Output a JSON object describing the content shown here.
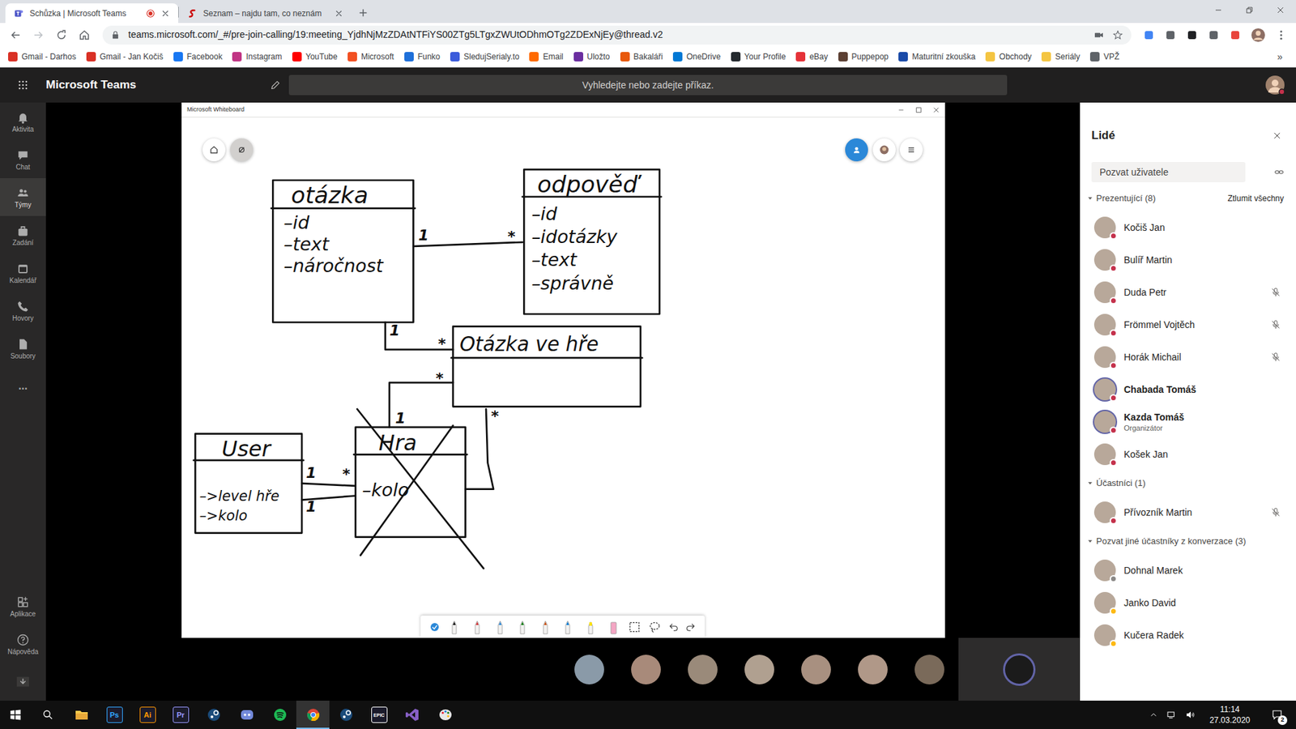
{
  "browser": {
    "tabs": [
      {
        "label": "Schůzka | Microsoft Teams",
        "selected": true,
        "recording": true
      },
      {
        "label": "Seznam – najdu tam, co neznám",
        "selected": false,
        "recording": false
      }
    ],
    "address": "teams.microsoft.com/_#/pre-join-calling/19:meeting_YjdhNjMzZDAtNTFiYS00ZTg5LTgxZWUtODhmOTg2ZDExNjEy@thread.v2",
    "bookmarks": [
      {
        "label": "Gmail - Darhos",
        "color": "#d93025"
      },
      {
        "label": "Gmail - Jan Kočiš",
        "color": "#d93025"
      },
      {
        "label": "Facebook",
        "color": "#1877f2"
      },
      {
        "label": "Instagram",
        "color": "#c13584"
      },
      {
        "label": "YouTube",
        "color": "#ff0000"
      },
      {
        "label": "Microsoft",
        "color": "#f25022"
      },
      {
        "label": "Funko",
        "color": "#1e6fd9"
      },
      {
        "label": "SledujSerialy.to",
        "color": "#3b5bdb"
      },
      {
        "label": "Email",
        "color": "#ff6a00"
      },
      {
        "label": "Uložto",
        "color": "#6b2fa0"
      },
      {
        "label": "Bakaláři",
        "color": "#e8590c"
      },
      {
        "label": "OneDrive",
        "color": "#0078d4"
      },
      {
        "label": "Your Profile",
        "color": "#24292e"
      },
      {
        "label": "eBay",
        "color": "#e53238"
      },
      {
        "label": "Puppepop",
        "color": "#5c4033"
      },
      {
        "label": "Maturitní zkouška",
        "color": "#1a4aa8"
      },
      {
        "label": "Obchody",
        "color": "#f4c542"
      },
      {
        "label": "Seriály",
        "color": "#f4c542"
      },
      {
        "label": "VPŽ",
        "color": "#5f6368"
      }
    ],
    "bookmarks_more": "»"
  },
  "teams": {
    "title": "Microsoft Teams",
    "search_placeholder": "Vyhledejte nebo zadejte příkaz.",
    "rail": [
      {
        "label": "Aktivita",
        "selected": false
      },
      {
        "label": "Chat",
        "selected": false
      },
      {
        "label": "Týmy",
        "selected": true
      },
      {
        "label": "Zadání",
        "selected": false
      },
      {
        "label": "Kalendář",
        "selected": false
      },
      {
        "label": "Hovory",
        "selected": false
      },
      {
        "label": "Soubory",
        "selected": false
      }
    ],
    "rail_more": "...",
    "rail_bottom": [
      {
        "label": "Aplikace"
      },
      {
        "label": "Nápověda"
      }
    ]
  },
  "whiteboard": {
    "title": "Microsoft Whiteboard",
    "classes": [
      {
        "name": "otázka",
        "fields": [
          "–id",
          "–text",
          "–náročnost"
        ],
        "crossed_out": false
      },
      {
        "name": "odpověď",
        "fields": [
          "–id",
          "–idotázky",
          "–text",
          "–správně"
        ],
        "crossed_out": false
      },
      {
        "name": "Otázka ve hře",
        "fields": [],
        "crossed_out": false
      },
      {
        "name": "User",
        "fields": [
          "–>level hře",
          "–>kolo"
        ],
        "crossed_out": false
      },
      {
        "name": "Hra",
        "fields": [
          "–kolo"
        ],
        "crossed_out": true
      }
    ],
    "links": [
      {
        "ends": [
          "1",
          "*"
        ]
      },
      {
        "ends": [
          "1",
          "*"
        ]
      },
      {
        "ends": [
          "*",
          "1"
        ]
      },
      {
        "ends": [
          "*"
        ]
      },
      {
        "ends": [
          "1",
          "*"
        ]
      },
      {
        "ends": [
          "1"
        ]
      }
    ]
  },
  "people": {
    "title": "Lidé",
    "invite_placeholder": "Pozvat uživatele",
    "groups": [
      {
        "label": "Prezentující (8)",
        "action": "Ztlumit všechny",
        "expanded": true,
        "members": [
          {
            "name": "Kočiš Jan",
            "muted": false,
            "highlighted": false,
            "status_color": "#c4314b"
          },
          {
            "name": "Bulíř Martin",
            "muted": false,
            "highlighted": false,
            "status_color": "#c4314b"
          },
          {
            "name": "Duda Petr",
            "muted": true,
            "highlighted": false,
            "status_color": "#c4314b"
          },
          {
            "name": "Frömmel Vojtěch",
            "muted": true,
            "highlighted": false,
            "status_color": "#c4314b"
          },
          {
            "name": "Horák Michail",
            "muted": true,
            "highlighted": false,
            "status_color": "#c4314b"
          },
          {
            "name": "Chabada Tomáš",
            "muted": false,
            "highlighted": true,
            "status_color": "#c4314b"
          },
          {
            "name": "Kazda Tomáš",
            "role": "Organizátor",
            "muted": false,
            "highlighted": true,
            "status_color": "#c4314b"
          },
          {
            "name": "Košek Jan",
            "muted": false,
            "highlighted": false,
            "status_color": "#c4314b"
          }
        ]
      },
      {
        "label": "Účastníci (1)",
        "expanded": true,
        "members": [
          {
            "name": "Přívozník Martin",
            "muted": true,
            "highlighted": false,
            "status_color": "#c4314b"
          }
        ]
      },
      {
        "label": "Pozvat jiné účastníky z konverzace (3)",
        "expanded": true,
        "members": [
          {
            "name": "Dohnal Marek",
            "muted": false,
            "highlighted": false,
            "status_color": "#8a8886"
          },
          {
            "name": "Janko David",
            "muted": false,
            "highlighted": false,
            "status_color": "#fdb913"
          },
          {
            "name": "Kučera Radek",
            "muted": false,
            "highlighted": false,
            "status_color": "#fdb913"
          }
        ]
      }
    ]
  },
  "taskbar": {
    "apps": [
      {
        "kind": "explorer",
        "active": false
      },
      {
        "kind": "label",
        "label": "Ps",
        "color": "#31a8ff",
        "active": false
      },
      {
        "kind": "label",
        "label": "Ai",
        "color": "#ff9a00",
        "active": false
      },
      {
        "kind": "label",
        "label": "Pr",
        "color": "#9999ff",
        "active": false
      },
      {
        "kind": "steam",
        "active": false
      },
      {
        "kind": "discord",
        "active": false
      },
      {
        "kind": "spotify",
        "active": false
      },
      {
        "kind": "chrome",
        "active": true
      },
      {
        "kind": "steam",
        "active": false
      },
      {
        "kind": "label",
        "label": "EPIC",
        "color": "#ffffff",
        "active": false
      },
      {
        "kind": "vs",
        "active": false
      },
      {
        "kind": "paint",
        "active": false
      }
    ],
    "time": "11:14",
    "date": "27.03.2020",
    "notifications": "2"
  }
}
